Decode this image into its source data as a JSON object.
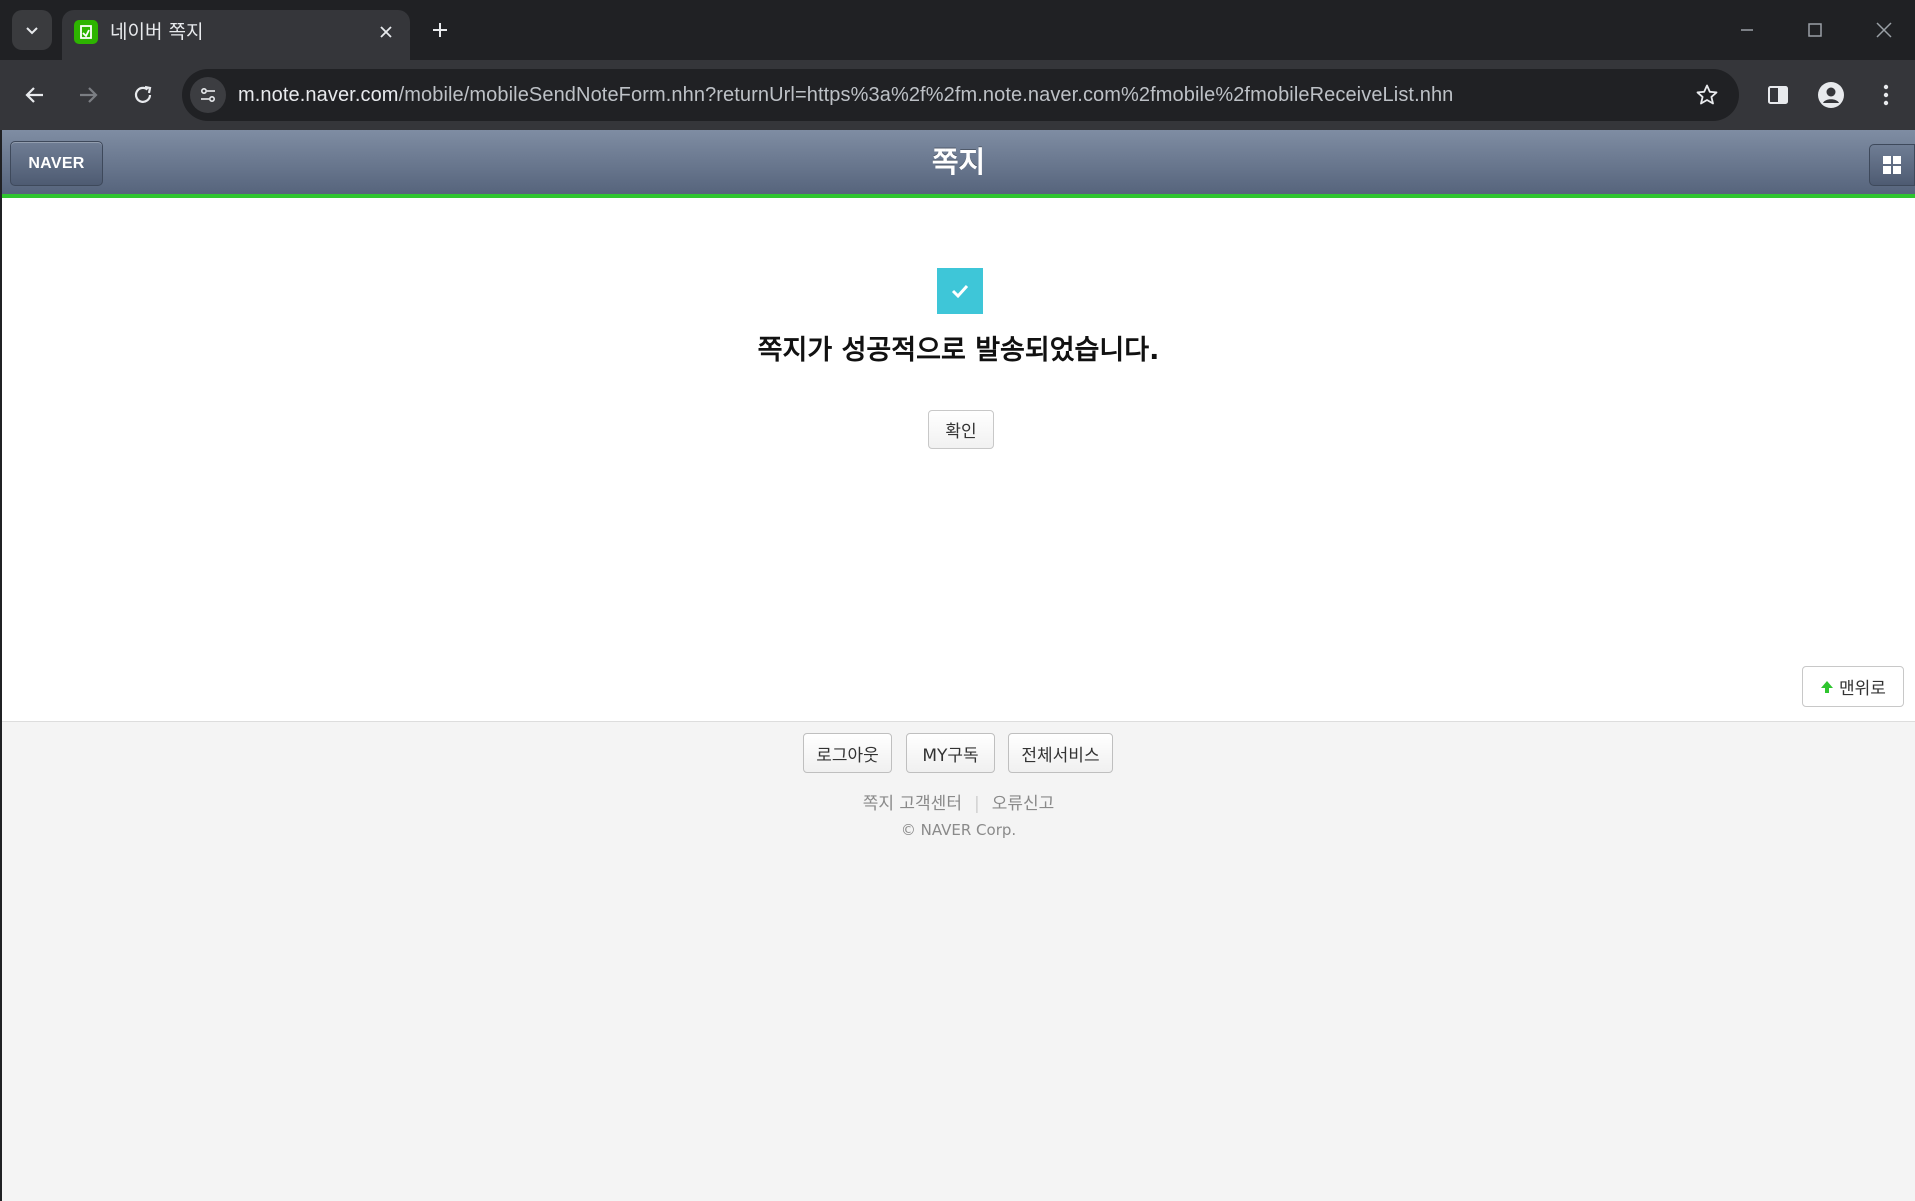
{
  "browser": {
    "tab": {
      "title": "네이버 쪽지"
    },
    "url": {
      "host": "m.note.naver.com",
      "path": "/mobile/mobileSendNoteForm.nhn?returnUrl=https%3a%2f%2fm.note.naver.com%2fmobile%2fmobileReceiveList.nhn"
    }
  },
  "header": {
    "naver_label": "NAVER",
    "title": "쪽지"
  },
  "main": {
    "success_message": "쪽지가 성공적으로 발송되었습니다.",
    "confirm_label": "확인",
    "top_label": "맨위로"
  },
  "footer": {
    "buttons": {
      "logout": "로그아웃",
      "my_subscribe": "MY구독",
      "all_services": "전체서비스"
    },
    "links": {
      "help_center": "쪽지 고객센터",
      "separator": "|",
      "error_report": "오류신고"
    },
    "copyright": "© NAVER Corp."
  },
  "colors": {
    "accent_green": "#2fc52f",
    "check_cyan": "#3ec6d8"
  }
}
